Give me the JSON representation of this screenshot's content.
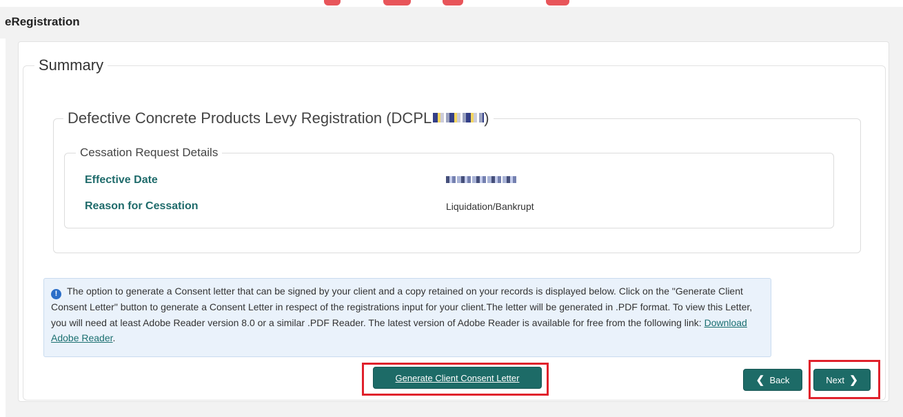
{
  "header": {
    "title": "eRegistration"
  },
  "summary": {
    "legend": "Summary",
    "registration": {
      "legend_prefix": "Defective Concrete Products Levy Registration (DCPL",
      "legend_suffix": ")",
      "cessation": {
        "legend": "Cessation Request Details",
        "fields": [
          {
            "label": "Effective Date",
            "value": ""
          },
          {
            "label": "Reason for Cessation",
            "value": "Liquidation/Bankrupt"
          }
        ]
      }
    }
  },
  "info": {
    "icon": "info-circle-icon",
    "text": "The option to generate a Consent letter that can be signed by your client and a copy retained on your records is displayed below. Click on the \"Generate Client Consent Letter\" button to generate a Consent Letter in respect of the registrations input for your client.The letter will be generated in .PDF format. To view this Letter, you will need at least Adobe Reader version 8.0 or a similar .PDF Reader. The latest version of Adobe Reader is available for free from the following link: ",
    "link_text": "Download Adobe Reader",
    "after_link": "."
  },
  "buttons": {
    "consent": "Generate Client Consent Letter",
    "back": "Back",
    "next": "Next",
    "back_icon": "chevron-left-icon",
    "next_icon": "chevron-right-icon"
  },
  "colors": {
    "accent": "#1d6b67",
    "label": "#1f6b6b",
    "highlight": "#e0202b",
    "info_bg": "#eaf2fb"
  }
}
